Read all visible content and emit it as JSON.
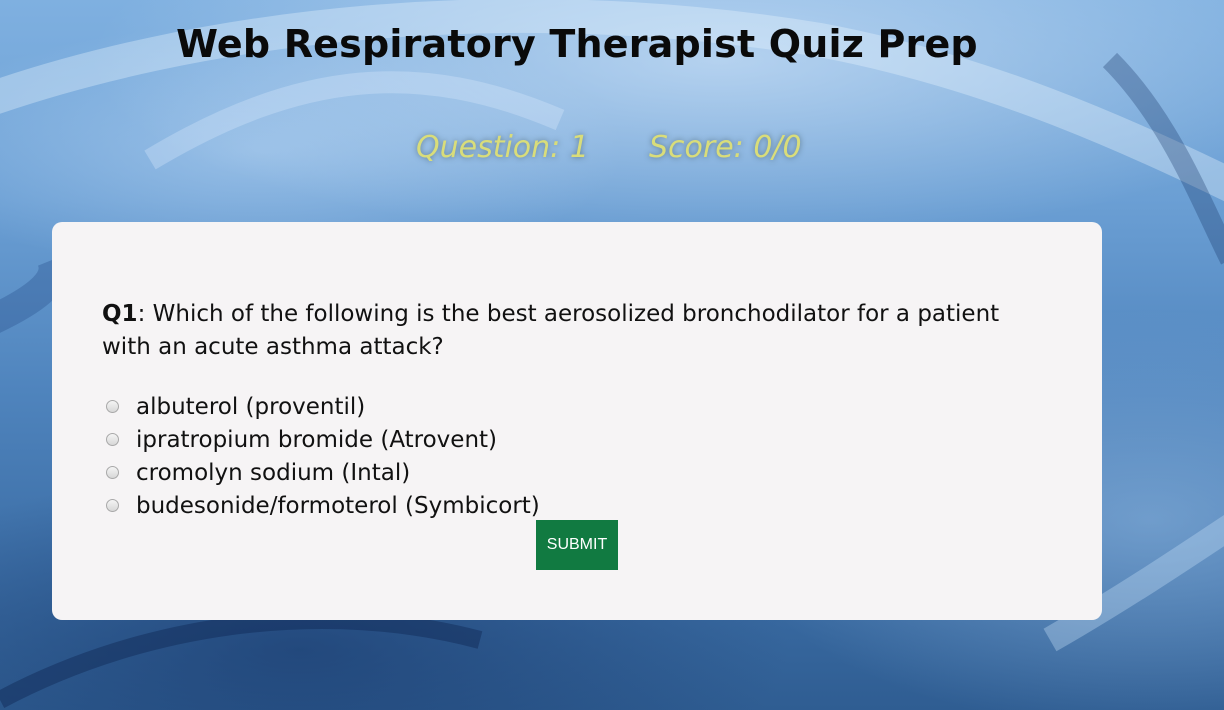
{
  "page": {
    "title": "Web Respiratory Therapist Quiz Prep"
  },
  "status": {
    "question": "Question: 1",
    "score": "Score: 0/0"
  },
  "quiz": {
    "question_label": "Q1",
    "question_separator": ":",
    "question_text": " Which of the following is the best aerosolized bronchodilator for a patient with an acute asthma attack?",
    "options": [
      {
        "label": "albuterol (proventil)",
        "selected": false
      },
      {
        "label": "ipratropium bromide (Atrovent)",
        "selected": false
      },
      {
        "label": "cromolyn sodium (Intal)",
        "selected": false
      },
      {
        "label": "budesonide/formoterol (Symbicort)",
        "selected": false
      }
    ],
    "submit_label": "SUBMIT"
  },
  "colors": {
    "background": "#6b9fd4",
    "card": "#f6f4f5",
    "status_text": "#d9dd7a",
    "submit_button": "#117a41"
  }
}
